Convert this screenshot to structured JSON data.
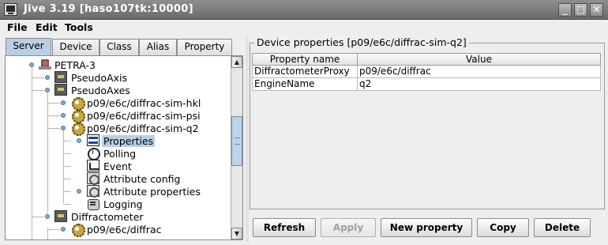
{
  "window": {
    "title": "Jive 3.19  [haso107tk:10000]",
    "icons": {
      "app": "jive-app-icon",
      "minimize": "minimize-icon",
      "maximize": "maximize-icon",
      "close": "close-icon"
    },
    "buttons": {
      "minimize": "_",
      "maximize": "□",
      "close": "✕"
    }
  },
  "menu": {
    "items": [
      "File",
      "Edit",
      "Tools"
    ]
  },
  "tabs": [
    {
      "label": "Server",
      "active": true
    },
    {
      "label": "Device",
      "active": false
    },
    {
      "label": "Class",
      "active": false
    },
    {
      "label": "Alias",
      "active": false
    },
    {
      "label": "Property",
      "active": false
    }
  ],
  "tree": {
    "nodes": [
      {
        "label": "PETRA-3",
        "icon": "petra-icon",
        "expanded": true
      },
      {
        "label": "PseudoAxis",
        "icon": "server-icon",
        "expanded": false
      },
      {
        "label": "PseudoAxes",
        "icon": "server-icon",
        "expanded": true
      },
      {
        "label": "p09/e6c/diffrac-sim-hkl",
        "icon": "device-gear-icon",
        "expanded": false
      },
      {
        "label": "p09/e6c/diffrac-sim-psi",
        "icon": "device-gear-icon",
        "expanded": false
      },
      {
        "label": "p09/e6c/diffrac-sim-q2",
        "icon": "device-gear-icon",
        "expanded": true
      },
      {
        "label": "Properties",
        "icon": "properties-icon",
        "selected": true
      },
      {
        "label": "Polling",
        "icon": "polling-clock-icon"
      },
      {
        "label": "Event",
        "icon": "event-chart-icon"
      },
      {
        "label": "Attribute config",
        "icon": "attribute-config-icon"
      },
      {
        "label": "Attribute properties",
        "icon": "attribute-properties-icon",
        "expanded": false
      },
      {
        "label": "Logging",
        "icon": "logging-icon"
      },
      {
        "label": "Diffractometer",
        "icon": "server-icon",
        "expanded": true
      },
      {
        "label": "p09/e6c/diffrac",
        "icon": "device-gear-icon",
        "expanded": false
      }
    ]
  },
  "scrollbar": {
    "up_arrow": "▲",
    "down_arrow": "▼"
  },
  "panel": {
    "title": "Device properties [p09/e6c/diffrac-sim-q2]",
    "columns": [
      "Property name",
      "Value"
    ],
    "rows": [
      [
        "DiffractometerProxy",
        "p09/e6c/diffrac"
      ],
      [
        "EngineName",
        "q2"
      ]
    ]
  },
  "buttons": {
    "refresh": "Refresh",
    "apply": "Apply",
    "new_property": "New property",
    "copy": "Copy",
    "delete": "Delete"
  },
  "colors": {
    "selection": "#b8cfe5",
    "titlebar": "#7b7b7b"
  }
}
